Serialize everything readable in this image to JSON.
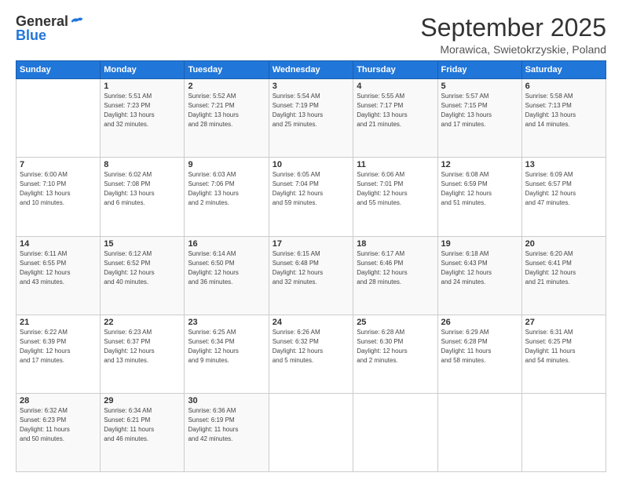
{
  "logo": {
    "general": "General",
    "blue": "Blue"
  },
  "title": "September 2025",
  "location": "Morawica, Swietokrzyskie, Poland",
  "days_of_week": [
    "Sunday",
    "Monday",
    "Tuesday",
    "Wednesday",
    "Thursday",
    "Friday",
    "Saturday"
  ],
  "weeks": [
    [
      {
        "day": "",
        "info": ""
      },
      {
        "day": "1",
        "info": "Sunrise: 5:51 AM\nSunset: 7:23 PM\nDaylight: 13 hours\nand 32 minutes."
      },
      {
        "day": "2",
        "info": "Sunrise: 5:52 AM\nSunset: 7:21 PM\nDaylight: 13 hours\nand 28 minutes."
      },
      {
        "day": "3",
        "info": "Sunrise: 5:54 AM\nSunset: 7:19 PM\nDaylight: 13 hours\nand 25 minutes."
      },
      {
        "day": "4",
        "info": "Sunrise: 5:55 AM\nSunset: 7:17 PM\nDaylight: 13 hours\nand 21 minutes."
      },
      {
        "day": "5",
        "info": "Sunrise: 5:57 AM\nSunset: 7:15 PM\nDaylight: 13 hours\nand 17 minutes."
      },
      {
        "day": "6",
        "info": "Sunrise: 5:58 AM\nSunset: 7:13 PM\nDaylight: 13 hours\nand 14 minutes."
      }
    ],
    [
      {
        "day": "7",
        "info": "Sunrise: 6:00 AM\nSunset: 7:10 PM\nDaylight: 13 hours\nand 10 minutes."
      },
      {
        "day": "8",
        "info": "Sunrise: 6:02 AM\nSunset: 7:08 PM\nDaylight: 13 hours\nand 6 minutes."
      },
      {
        "day": "9",
        "info": "Sunrise: 6:03 AM\nSunset: 7:06 PM\nDaylight: 13 hours\nand 2 minutes."
      },
      {
        "day": "10",
        "info": "Sunrise: 6:05 AM\nSunset: 7:04 PM\nDaylight: 12 hours\nand 59 minutes."
      },
      {
        "day": "11",
        "info": "Sunrise: 6:06 AM\nSunset: 7:01 PM\nDaylight: 12 hours\nand 55 minutes."
      },
      {
        "day": "12",
        "info": "Sunrise: 6:08 AM\nSunset: 6:59 PM\nDaylight: 12 hours\nand 51 minutes."
      },
      {
        "day": "13",
        "info": "Sunrise: 6:09 AM\nSunset: 6:57 PM\nDaylight: 12 hours\nand 47 minutes."
      }
    ],
    [
      {
        "day": "14",
        "info": "Sunrise: 6:11 AM\nSunset: 6:55 PM\nDaylight: 12 hours\nand 43 minutes."
      },
      {
        "day": "15",
        "info": "Sunrise: 6:12 AM\nSunset: 6:52 PM\nDaylight: 12 hours\nand 40 minutes."
      },
      {
        "day": "16",
        "info": "Sunrise: 6:14 AM\nSunset: 6:50 PM\nDaylight: 12 hours\nand 36 minutes."
      },
      {
        "day": "17",
        "info": "Sunrise: 6:15 AM\nSunset: 6:48 PM\nDaylight: 12 hours\nand 32 minutes."
      },
      {
        "day": "18",
        "info": "Sunrise: 6:17 AM\nSunset: 6:46 PM\nDaylight: 12 hours\nand 28 minutes."
      },
      {
        "day": "19",
        "info": "Sunrise: 6:18 AM\nSunset: 6:43 PM\nDaylight: 12 hours\nand 24 minutes."
      },
      {
        "day": "20",
        "info": "Sunrise: 6:20 AM\nSunset: 6:41 PM\nDaylight: 12 hours\nand 21 minutes."
      }
    ],
    [
      {
        "day": "21",
        "info": "Sunrise: 6:22 AM\nSunset: 6:39 PM\nDaylight: 12 hours\nand 17 minutes."
      },
      {
        "day": "22",
        "info": "Sunrise: 6:23 AM\nSunset: 6:37 PM\nDaylight: 12 hours\nand 13 minutes."
      },
      {
        "day": "23",
        "info": "Sunrise: 6:25 AM\nSunset: 6:34 PM\nDaylight: 12 hours\nand 9 minutes."
      },
      {
        "day": "24",
        "info": "Sunrise: 6:26 AM\nSunset: 6:32 PM\nDaylight: 12 hours\nand 5 minutes."
      },
      {
        "day": "25",
        "info": "Sunrise: 6:28 AM\nSunset: 6:30 PM\nDaylight: 12 hours\nand 2 minutes."
      },
      {
        "day": "26",
        "info": "Sunrise: 6:29 AM\nSunset: 6:28 PM\nDaylight: 11 hours\nand 58 minutes."
      },
      {
        "day": "27",
        "info": "Sunrise: 6:31 AM\nSunset: 6:25 PM\nDaylight: 11 hours\nand 54 minutes."
      }
    ],
    [
      {
        "day": "28",
        "info": "Sunrise: 6:32 AM\nSunset: 6:23 PM\nDaylight: 11 hours\nand 50 minutes."
      },
      {
        "day": "29",
        "info": "Sunrise: 6:34 AM\nSunset: 6:21 PM\nDaylight: 11 hours\nand 46 minutes."
      },
      {
        "day": "30",
        "info": "Sunrise: 6:36 AM\nSunset: 6:19 PM\nDaylight: 11 hours\nand 42 minutes."
      },
      {
        "day": "",
        "info": ""
      },
      {
        "day": "",
        "info": ""
      },
      {
        "day": "",
        "info": ""
      },
      {
        "day": "",
        "info": ""
      }
    ]
  ]
}
